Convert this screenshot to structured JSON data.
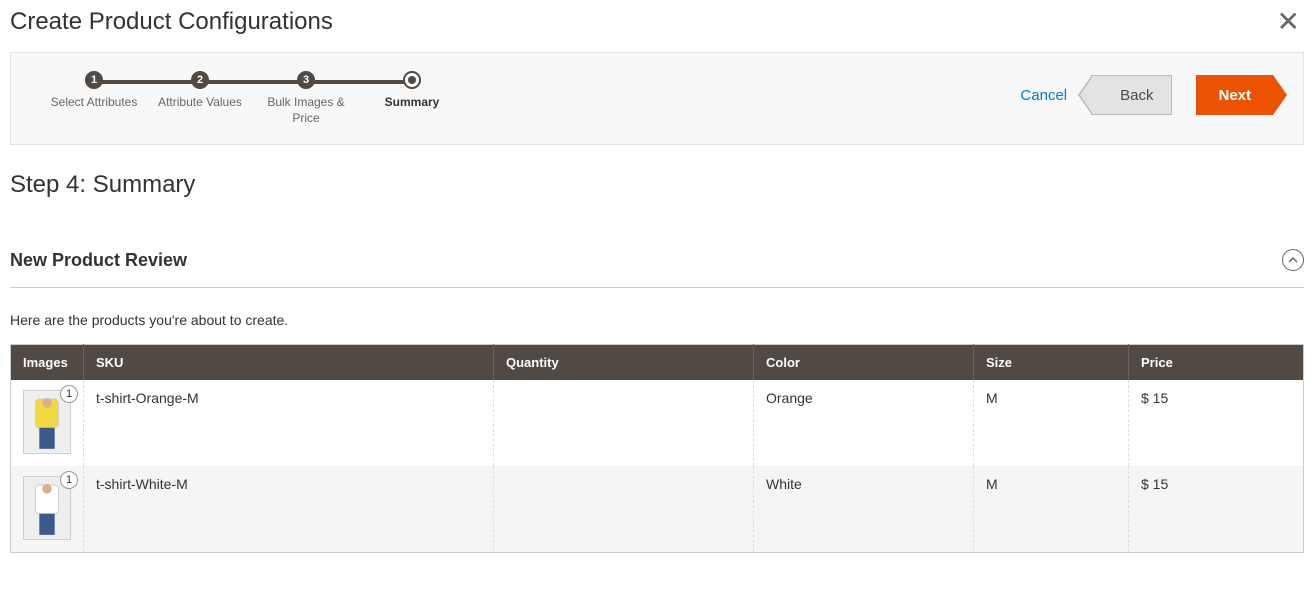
{
  "modal": {
    "title": "Create Product Configurations"
  },
  "wizard": {
    "steps": [
      {
        "num": "1",
        "label": "Select Attributes"
      },
      {
        "num": "2",
        "label": "Attribute Values"
      },
      {
        "num": "3",
        "label": "Bulk Images & Price"
      },
      {
        "num": "",
        "label": "Summary"
      }
    ],
    "actions": {
      "cancel": "Cancel",
      "back": "Back",
      "next": "Next"
    }
  },
  "page": {
    "step_title": "Step 4: Summary",
    "section_title": "New Product Review",
    "intro": "Here are the products you're about to create."
  },
  "table": {
    "headers": {
      "images": "Images",
      "sku": "SKU",
      "quantity": "Quantity",
      "color": "Color",
      "size": "Size",
      "price": "Price"
    },
    "rows": [
      {
        "badge": "1",
        "sku": "t-shirt-Orange-M",
        "quantity": "",
        "color": "Orange",
        "size": "M",
        "price": "$ 15",
        "thumb_color": "#f2d93f"
      },
      {
        "badge": "1",
        "sku": "t-shirt-White-M",
        "quantity": "",
        "color": "White",
        "size": "M",
        "price": "$ 15",
        "thumb_color": "#ffffff"
      }
    ]
  }
}
